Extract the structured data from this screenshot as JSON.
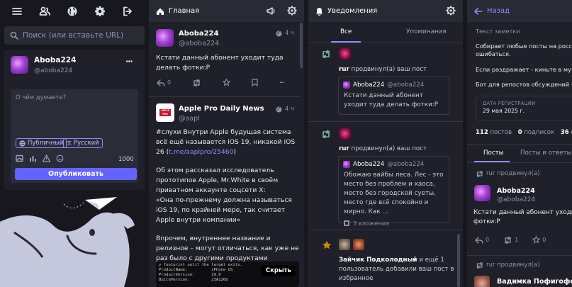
{
  "nav": {
    "icons": [
      "menu-icon",
      "people-icon",
      "globe-icon",
      "gear-icon",
      "logout-icon"
    ]
  },
  "search": {
    "placeholder": "Поиск (или вставьте URL)"
  },
  "profile": {
    "name": "Aboba224",
    "handle": "@aboba224",
    "more": "···"
  },
  "compose": {
    "placeholder": "О чём думаете?",
    "visibility": "Публичный",
    "language": "Русский",
    "char_count": "1000",
    "publish_label": "Опубликовать"
  },
  "home": {
    "title": "Главная",
    "posts": [
      {
        "name": "Aboba224",
        "handle": "@aboba224",
        "time": "4 ч",
        "text": "Кстати данный абонент уходит туда делать фотки:P",
        "reply_count": "0"
      },
      {
        "name": "Apple Pro Daily News",
        "handle": "@aapl",
        "time": "4 ч",
        "avatar_text": "APPLE PRO DAILY",
        "p1": "#слухи Внутри Apple будущая система всё ещё называется iOS 19, никакой iOS 26 (",
        "p1_link": "t.me/aaplpro/25460",
        "p1_end": ")",
        "p2": "Об этом рассказал исследователь прототипов Apple, Mr.White в своём приватном аккаунте соцсети X:",
        "p3": "«Она по-прежнему должна называться iOS 19, по крайней мере, так считает Apple внутри компании»",
        "p4": "Впрочем, внутреннее название и релизное – могут отличаться, как уже не раз было с другими продуктами компании",
        "code_lines": [
          "y footprint until the target exits.",
          "ProductName:          iPhone OS",
          "ProductVersion:       19.0",
          "BuildVersion:         23A226b"
        ],
        "hide_label": "Скрыть"
      }
    ]
  },
  "notifications": {
    "title": "Уведомления",
    "tabs": [
      "Все",
      "Упоминания"
    ],
    "items": [
      {
        "user": "rur",
        "action": " продвинул(а) ваш пост",
        "card_name": "Aboba224",
        "card_handle": "@aboba224",
        "card_text": "Кстати данный абонент уходит туда делать фотки:P"
      },
      {
        "user": "rur",
        "action": " продвинул(а) ваш пост",
        "card_name": "Aboba224",
        "card_handle": "@aboba224",
        "card_text": "Обожаю вайбы леса. Лес - это место без проблем и хаоса, место без городской суеты, место где всё спокойно и мирно. Как ...",
        "attachments": "3 вложения"
      },
      {
        "user": "Зайчик Подколодный",
        "action": " и ещё 1 пользователь добавили ваш пост в избранное"
      }
    ]
  },
  "profile_col": {
    "back_label": "Назад",
    "note_placeholder": "Текст заметки",
    "bio1": "Собирает любые посты на российском, но может ошибаться.",
    "bio2": "Если раздражает - киньте в мут.",
    "bio3_prefix": "Бот для репостов обсуждений - ",
    "bio3_link": "@p",
    "reg_label": "ДАТА РЕГИСТРАЦИИ",
    "reg_date": "29 мая 2025 г.",
    "posts_count": "112",
    "posts_label": " постов",
    "following_count": "0",
    "following_label": " подписок",
    "followers_count": "36",
    "followers_label": " по",
    "tabs": [
      "Посты",
      "Посты и ответы"
    ],
    "boost1": "rur продвинул(а)",
    "post_name": "Aboba224",
    "post_handle": "@aboba224",
    "post_text": "Кстати данный абонент уходит туда делать фотки:P",
    "reply_count": "0",
    "boost_count": "1",
    "fav_count": "0",
    "boost2": "rur продвинул(а)",
    "next_name": "Вадимка Пофигофф"
  },
  "colors": {
    "accent": "#6364ff",
    "background": "#17171d",
    "column": "#1f2029",
    "header": "#282a34",
    "favourite": "#ca8f04",
    "boost": "#79bd9a"
  }
}
